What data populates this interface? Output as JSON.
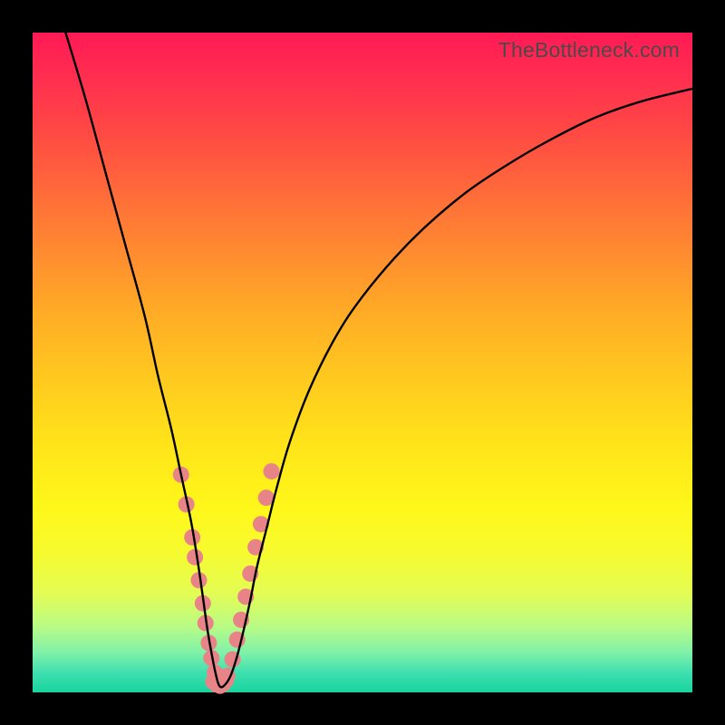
{
  "branding": "TheBottleneck.com",
  "chart_data": {
    "type": "line",
    "title": "",
    "xlabel": "",
    "ylabel": "",
    "xlim": [
      0,
      100
    ],
    "ylim": [
      0,
      100
    ],
    "curve": {
      "x": [
        5,
        8,
        11,
        14,
        17,
        19,
        21,
        22.5,
        24,
        25,
        25.8,
        26.5,
        27.2,
        27.8,
        28.3,
        29,
        30,
        31,
        32,
        33,
        34,
        35.5,
        37,
        39,
        42,
        46,
        50,
        55,
        60,
        66,
        72,
        78,
        85,
        92,
        100
      ],
      "y": [
        100,
        90,
        79,
        68,
        57,
        48,
        40,
        33,
        26,
        20,
        14.5,
        9.5,
        5.5,
        2.6,
        1.0,
        1.0,
        2.5,
        5.5,
        9.5,
        14,
        19,
        25,
        31,
        38,
        46,
        54,
        60,
        66,
        71,
        76,
        80,
        83.5,
        87,
        89.5,
        91.5
      ]
    },
    "markers_left": {
      "x": [
        22.5,
        23.3,
        24.2,
        24.6,
        25.2,
        25.8,
        26.2,
        26.7,
        27.1,
        27.6
      ],
      "y": [
        33.0,
        28.5,
        23.5,
        20.5,
        17.0,
        13.5,
        10.5,
        7.5,
        5.2,
        3.0
      ]
    },
    "markers_right": {
      "x": [
        29.5,
        30.3,
        31.0,
        31.6,
        32.3,
        33.0,
        33.8,
        34.6,
        35.4,
        36.2
      ],
      "y": [
        2.5,
        5.0,
        8.0,
        11.0,
        14.5,
        18.0,
        22.0,
        25.5,
        29.5,
        33.5
      ]
    },
    "markers_bottom": {
      "x": [
        27.4,
        27.9,
        28.4,
        28.9,
        29.3
      ],
      "y": [
        1.6,
        1.2,
        1.0,
        1.3,
        1.9
      ]
    },
    "style": {
      "curve_stroke": "#000000",
      "curve_width": 2.4,
      "marker_fill": "#e88488",
      "marker_radius": 9
    }
  }
}
